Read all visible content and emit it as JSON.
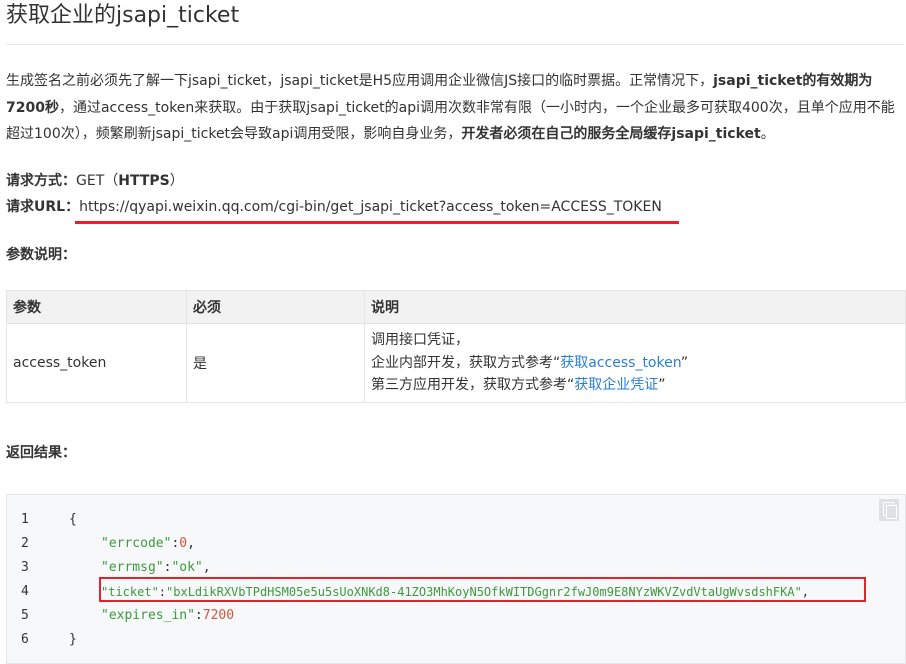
{
  "page": {
    "title": "获取企业的jsapi_ticket"
  },
  "intro": {
    "p1": "生成签名之前必须先了解一下jsapi_ticket，jsapi_ticket是H5应用调用企业微信JS接口的临时票据。正常情况下，",
    "p1_bold": "jsapi_ticket的有效期为7200秒",
    "p2": "，通过access_token来获取。由于获取jsapi_ticket的api调用次数非常有限（一小时内，一个企业最多可获取400次，且单个应用不能超过100次），频繁刷新jsapi_ticket会导致api调用受限，影响自身业务，",
    "p2_bold": "开发者必须在自己的服务全局缓存jsapi_ticket",
    "p3": "。"
  },
  "request": {
    "method_label": "请求方式：",
    "method_value": "GET（",
    "method_bold": "HTTPS",
    "method_close": "）",
    "url_label": "请求URL：",
    "url_value": "https://qyapi.weixin.qq.com/cgi-bin/get_jsapi_ticket?access_token=ACCESS_TOKEN"
  },
  "params_section": {
    "title": "参数说明：",
    "headers": [
      "参数",
      "必须",
      "说明"
    ],
    "rows": [
      {
        "name": "access_token",
        "required": "是",
        "desc_line1": "调用接口凭证，",
        "desc_line2_prefix": "企业内部开发，获取方式参考“",
        "desc_line2_link": "获取access_token",
        "desc_line2_suffix": "”",
        "desc_line3_prefix": "第三方应用开发，获取方式参考“",
        "desc_line3_link": "获取企业凭证",
        "desc_line3_suffix": "”"
      }
    ]
  },
  "result_section": {
    "title": "返回结果："
  },
  "code": {
    "lines": [
      {
        "n": "1",
        "text": "{"
      },
      {
        "n": "2",
        "key": "\"errcode\"",
        "sep": ":",
        "val": "0",
        "tail": ","
      },
      {
        "n": "3",
        "key": "\"errmsg\"",
        "sep": ":",
        "val": "\"ok\"",
        "tail": ","
      },
      {
        "n": "4",
        "key": "\"ticket\"",
        "sep": ":",
        "val": "\"bxLdikRXVbTPdHSM05e5u5sUoXNKd8-41ZO3MhKoyN5OfkWITDGgnr2fwJ0m9E8NYzWKVZvdVtaUgWvsdshFKA\"",
        "tail": ","
      },
      {
        "n": "5",
        "key": "\"expires_in\"",
        "sep": ":",
        "val": "7200",
        "tail": ""
      },
      {
        "n": "6",
        "text": "}"
      }
    ]
  },
  "colors": {
    "highlight_red": "#e8202d",
    "link_blue": "#2a7fd4",
    "code_string_green": "#3c9a3c",
    "code_number": "#d4553a"
  },
  "icons": {
    "copy": "copy-icon"
  }
}
